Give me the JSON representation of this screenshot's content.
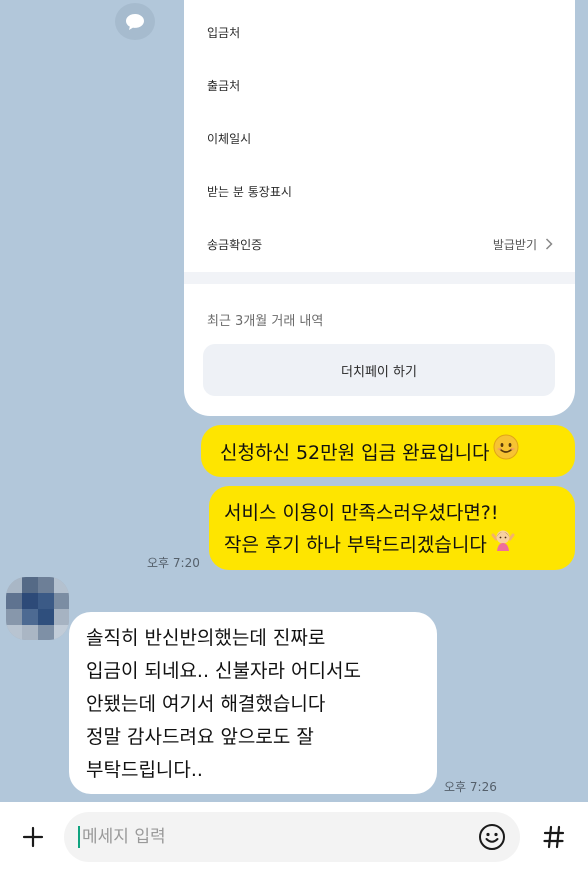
{
  "transfer_card": {
    "rows": [
      {
        "label": "입금처"
      },
      {
        "label": "출금처"
      },
      {
        "label": "이체일시"
      },
      {
        "label": "받는 분 통장표시"
      },
      {
        "label": "송금확인증",
        "action": "발급받기"
      }
    ],
    "recent_history": "최근 3개월 거래 내역",
    "pay_button": "더치페이 하기"
  },
  "messages": [
    {
      "sender": "me",
      "text": "신청하신 52만원 입금 완료입니다",
      "emoji": "smiling-face-icon"
    },
    {
      "sender": "me",
      "lines": [
        "서비스 이용이 만족스러우셨다면?!",
        "작은 후기 하나 부탁드리겠습니다"
      ],
      "emoji": "girl-raising-hands-icon",
      "time": "오후 7:20"
    },
    {
      "sender": "other",
      "lines": [
        "솔직히 반신반의했는데 진짜로",
        "입금이 되네요.. 신불자라 어디서도",
        "안됐는데 여기서 해결했습니다",
        "정말 감사드려요 앞으로도 잘",
        "부탁드립니다.."
      ],
      "time": "오후 7:26"
    }
  ],
  "input_bar": {
    "placeholder": "메세지 입력"
  },
  "colors": {
    "background": "#b2c7da",
    "my_bubble": "#fee500",
    "other_bubble": "#ffffff",
    "caret": "#10a37f"
  }
}
